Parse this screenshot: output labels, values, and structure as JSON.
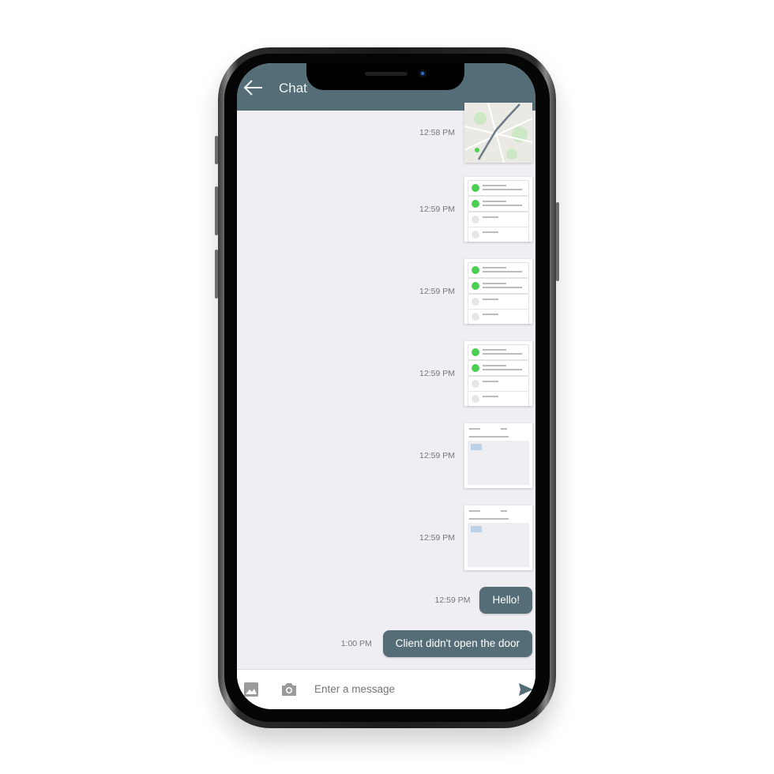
{
  "header": {
    "title": "Chat",
    "back_icon": "arrow-left-icon"
  },
  "messages": [
    {
      "time": "12:58 PM",
      "type": "image",
      "content": "map-route-thumbnail"
    },
    {
      "time": "12:59 PM",
      "type": "image",
      "content": "delivery-list-screenshot"
    },
    {
      "time": "12:59 PM",
      "type": "image",
      "content": "delivery-list-screenshot"
    },
    {
      "time": "12:59 PM",
      "type": "image",
      "content": "delivery-list-screenshot"
    },
    {
      "time": "12:59 PM",
      "type": "image",
      "content": "photo-note-screenshot"
    },
    {
      "time": "12:59 PM",
      "type": "image",
      "content": "photo-note-screenshot"
    },
    {
      "time": "12:59 PM",
      "type": "text",
      "text": "Hello!"
    },
    {
      "time": "1:00 PM",
      "type": "text",
      "text": "Client didn't open the door"
    }
  ],
  "composer": {
    "placeholder": "Enter a message",
    "gallery_icon": "image-icon",
    "camera_icon": "camera-icon",
    "send_icon": "send-icon"
  },
  "colors": {
    "accent": "#546d77",
    "background": "#efeff3"
  }
}
